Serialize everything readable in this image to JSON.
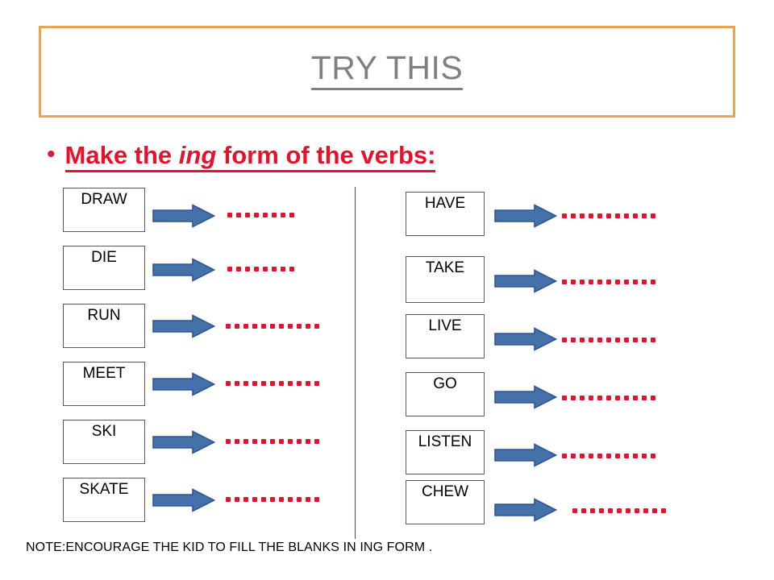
{
  "slide": {
    "title": "TRY THIS",
    "title_color": "#808080",
    "header_border_color": "#E8A158",
    "accent_red": "#E8112D",
    "arrow_color": "#4472A8",
    "arrow_border_color": "#2E5496",
    "box_border_color": "#595959",
    "divider_color": "#44546A",
    "background": "#FFFFFF"
  },
  "instruction": {
    "bullet_glyph": "•",
    "text_part1": "Make the ",
    "text_italic": "ing",
    "text_part2": " form of the verbs:",
    "full_text": "Make the ing form of the verbs:"
  },
  "columns": [
    {
      "name": "left-column",
      "items": [
        {
          "word": "DRAW",
          "blank_dots": 8,
          "blank_placeholder": "........"
        },
        {
          "word": "DIE",
          "blank_dots": 8,
          "blank_placeholder": "........"
        },
        {
          "word": "RUN",
          "blank_dots": 11,
          "blank_placeholder": "..........."
        },
        {
          "word": "MEET",
          "blank_dots": 11,
          "blank_placeholder": "..........."
        },
        {
          "word": "SKI",
          "blank_dots": 11,
          "blank_placeholder": "..........."
        },
        {
          "word": "SKATE",
          "blank_dots": 11,
          "blank_placeholder": "..........."
        }
      ]
    },
    {
      "name": "right-column",
      "items": [
        {
          "word": "HAVE",
          "blank_dots": 11,
          "blank_placeholder": "..........."
        },
        {
          "word": "TAKE",
          "blank_dots": 11,
          "blank_placeholder": "..........."
        },
        {
          "word": "LIVE",
          "blank_dots": 11,
          "blank_placeholder": "..........."
        },
        {
          "word": "GO",
          "blank_dots": 11,
          "blank_placeholder": "..........."
        },
        {
          "word": "LISTEN",
          "blank_dots": 11,
          "blank_placeholder": "..........."
        },
        {
          "word": "CHEW",
          "blank_dots": 11,
          "blank_placeholder": "..........."
        }
      ]
    }
  ],
  "note": {
    "text": "NOTE:ENCOURAGE THE KID TO FILL THE BLANKS IN ING FORM ."
  }
}
